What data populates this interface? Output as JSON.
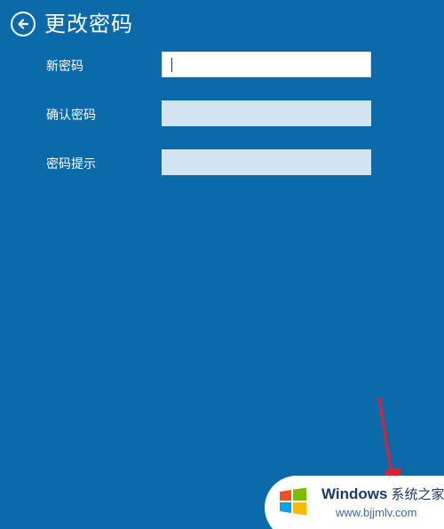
{
  "header": {
    "back_icon": "back-arrow-circle-icon",
    "title": "更改密码"
  },
  "form": {
    "fields": [
      {
        "label": "新密码",
        "value": "",
        "placeholder": "",
        "state": "focused"
      },
      {
        "label": "确认密码",
        "value": "",
        "placeholder": "",
        "state": "disabled"
      },
      {
        "label": "密码提示",
        "value": "",
        "placeholder": "",
        "state": "disabled"
      }
    ]
  },
  "watermark": {
    "brand": "Windows",
    "brand_cn": "系统之家",
    "url": "www.bjjmlv.com"
  },
  "colors": {
    "background": "#0a6aaa",
    "input_active": "#ffffff",
    "input_inactive": "#d2e4f1",
    "annotation": "#e0202f"
  }
}
